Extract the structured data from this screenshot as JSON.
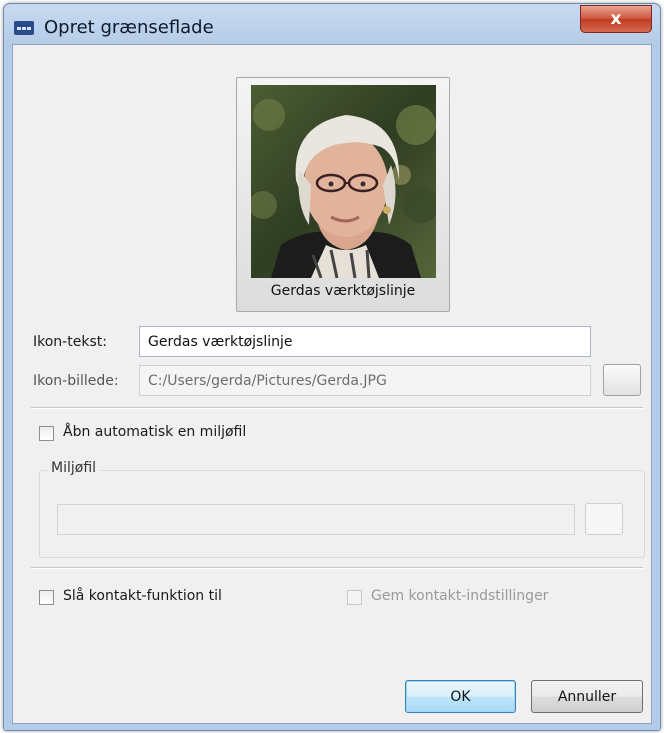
{
  "window": {
    "title": "Opret grænseflade",
    "close_label": "x"
  },
  "avatar": {
    "caption": "Gerdas værktøjslinje"
  },
  "icon_text": {
    "label": "Ikon-tekst:",
    "value": "Gerdas værktøjslinje"
  },
  "icon_image": {
    "label": "Ikon-billede:",
    "value": "C:/Users/gerda/Pictures/Gerda.JPG"
  },
  "auto_open": {
    "label": "Åbn automatisk en miljøfil",
    "checked": false
  },
  "environment_file": {
    "group_title": "Miljøfil",
    "value": ""
  },
  "contact": {
    "label": "Slå kontakt-funktion til",
    "checked": false,
    "save_label": "Gem kontakt-indstillinger",
    "save_enabled": false
  },
  "buttons": {
    "ok": "OK",
    "cancel": "Annuller"
  },
  "colors": {
    "accent": "#3c7fb1",
    "close": "#c03a22",
    "titlebar": "#b5cce8"
  }
}
